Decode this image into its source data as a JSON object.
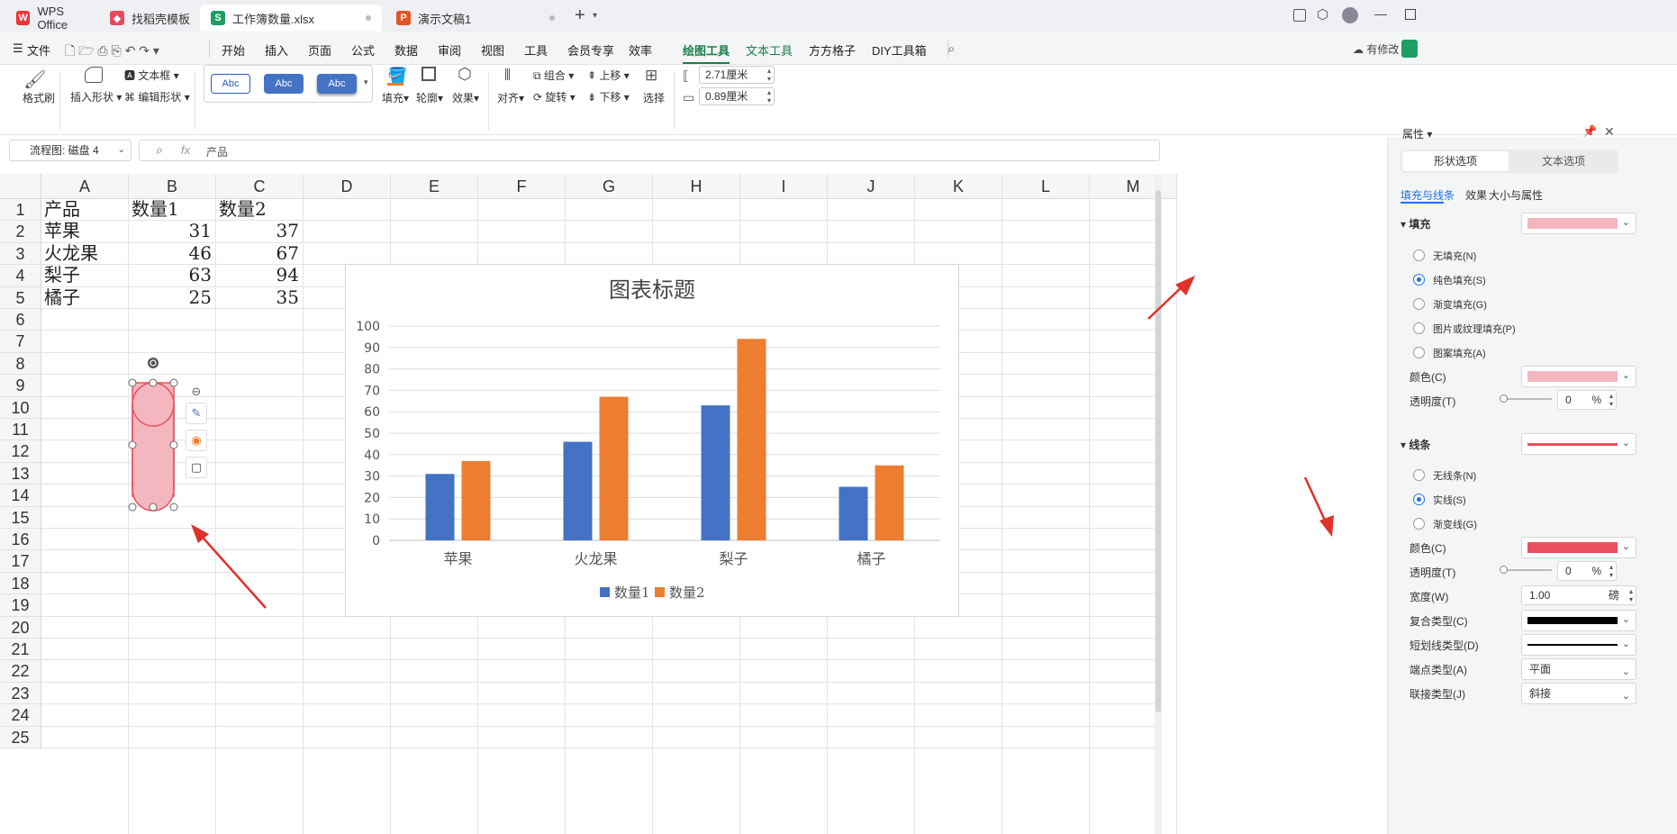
{
  "tabs": {
    "t0": "WPS Office",
    "t1": "找稻壳模板",
    "t2": "工作簿数量.xlsx",
    "t3": "演示文稿1",
    "plus": "+"
  },
  "menu": {
    "file": "文件",
    "items": [
      "开始",
      "插入",
      "页面",
      "公式",
      "数据",
      "审阅",
      "视图",
      "工具",
      "会员专享",
      "效率",
      "绘图工具",
      "文本工具",
      "方方格子",
      "DIY工具箱"
    ],
    "has_changes": "有修改"
  },
  "ribbon": {
    "format_brush": "格式刷",
    "insert_shape": "插入形状",
    "text_box": "文本框",
    "edit_shape": "编辑形状",
    "style1": "Abc",
    "style2": "Abc",
    "style3": "Abc",
    "fill": "填充",
    "outline": "轮廓",
    "effect": "效果",
    "align": "对齐",
    "group": "组合",
    "rotate": "旋转",
    "up": "上移",
    "down": "下移",
    "select": "选择",
    "height": "2.71厘米",
    "width": "0.89厘米"
  },
  "formula": {
    "name_box": "流程图: 磁盘 4",
    "fx": "fx",
    "content": "产品"
  },
  "sheet": {
    "columns": [
      "A",
      "B",
      "C",
      "D",
      "E",
      "F",
      "G",
      "H",
      "I",
      "J",
      "K",
      "L",
      "M"
    ],
    "rows": [
      "1",
      "2",
      "3",
      "4",
      "5",
      "6",
      "7",
      "8",
      "9",
      "10",
      "11",
      "12",
      "13",
      "14",
      "15",
      "16",
      "17",
      "18",
      "19",
      "20",
      "21",
      "22",
      "23",
      "24",
      "25"
    ],
    "data": [
      [
        "产品",
        "数量1",
        "数量2"
      ],
      [
        "苹果",
        "31",
        "37"
      ],
      [
        "火龙果",
        "46",
        "67"
      ],
      [
        "梨子",
        "63",
        "94"
      ],
      [
        "橘子",
        "25",
        "35"
      ]
    ]
  },
  "chart_data": {
    "type": "bar",
    "title": "图表标题",
    "categories": [
      "苹果",
      "火龙果",
      "梨子",
      "橘子"
    ],
    "series": [
      {
        "name": "数量1",
        "values": [
          31,
          46,
          63,
          25
        ],
        "color": "#4472c4"
      },
      {
        "name": "数量2",
        "values": [
          37,
          67,
          94,
          35
        ],
        "color": "#ed7d31"
      }
    ],
    "ylim": [
      0,
      100
    ],
    "yticks": [
      "0",
      "10",
      "20",
      "30",
      "40",
      "50",
      "60",
      "70",
      "80",
      "90",
      "100"
    ],
    "grid": true,
    "legend": "bottom"
  },
  "panel": {
    "title": "属性",
    "tab_shape": "形状选项",
    "tab_text": "文本选项",
    "sub_fill_line": "填充与线条",
    "sub_effect": "效果",
    "sub_size": "大小与属性",
    "fill_section": "填充",
    "fill_options": [
      "无填充(N)",
      "纯色填充(S)",
      "渐变填充(G)",
      "图片或纹理填充(P)",
      "图案填充(A)"
    ],
    "color_label": "颜色(C)",
    "transparency_label": "透明度(T)",
    "fill_transparency": "0",
    "percent": "%",
    "line_section": "线条",
    "line_options": [
      "无线条(N)",
      "实线(S)",
      "渐变线(G)"
    ],
    "line_color_label": "颜色(C)",
    "line_transparency_label": "透明度(T)",
    "line_transparency": "0",
    "width_label": "宽度(W)",
    "width_value": "1.00",
    "width_unit": "磅",
    "compound_label": "复合类型(C)",
    "dash_label": "短划线类型(D)",
    "cap_label": "端点类型(A)",
    "cap_value": "平面",
    "join_label": "联接类型(J)",
    "join_value": "斜接",
    "fill_color": "#f4b6bf",
    "line_color": "#e8505f"
  }
}
